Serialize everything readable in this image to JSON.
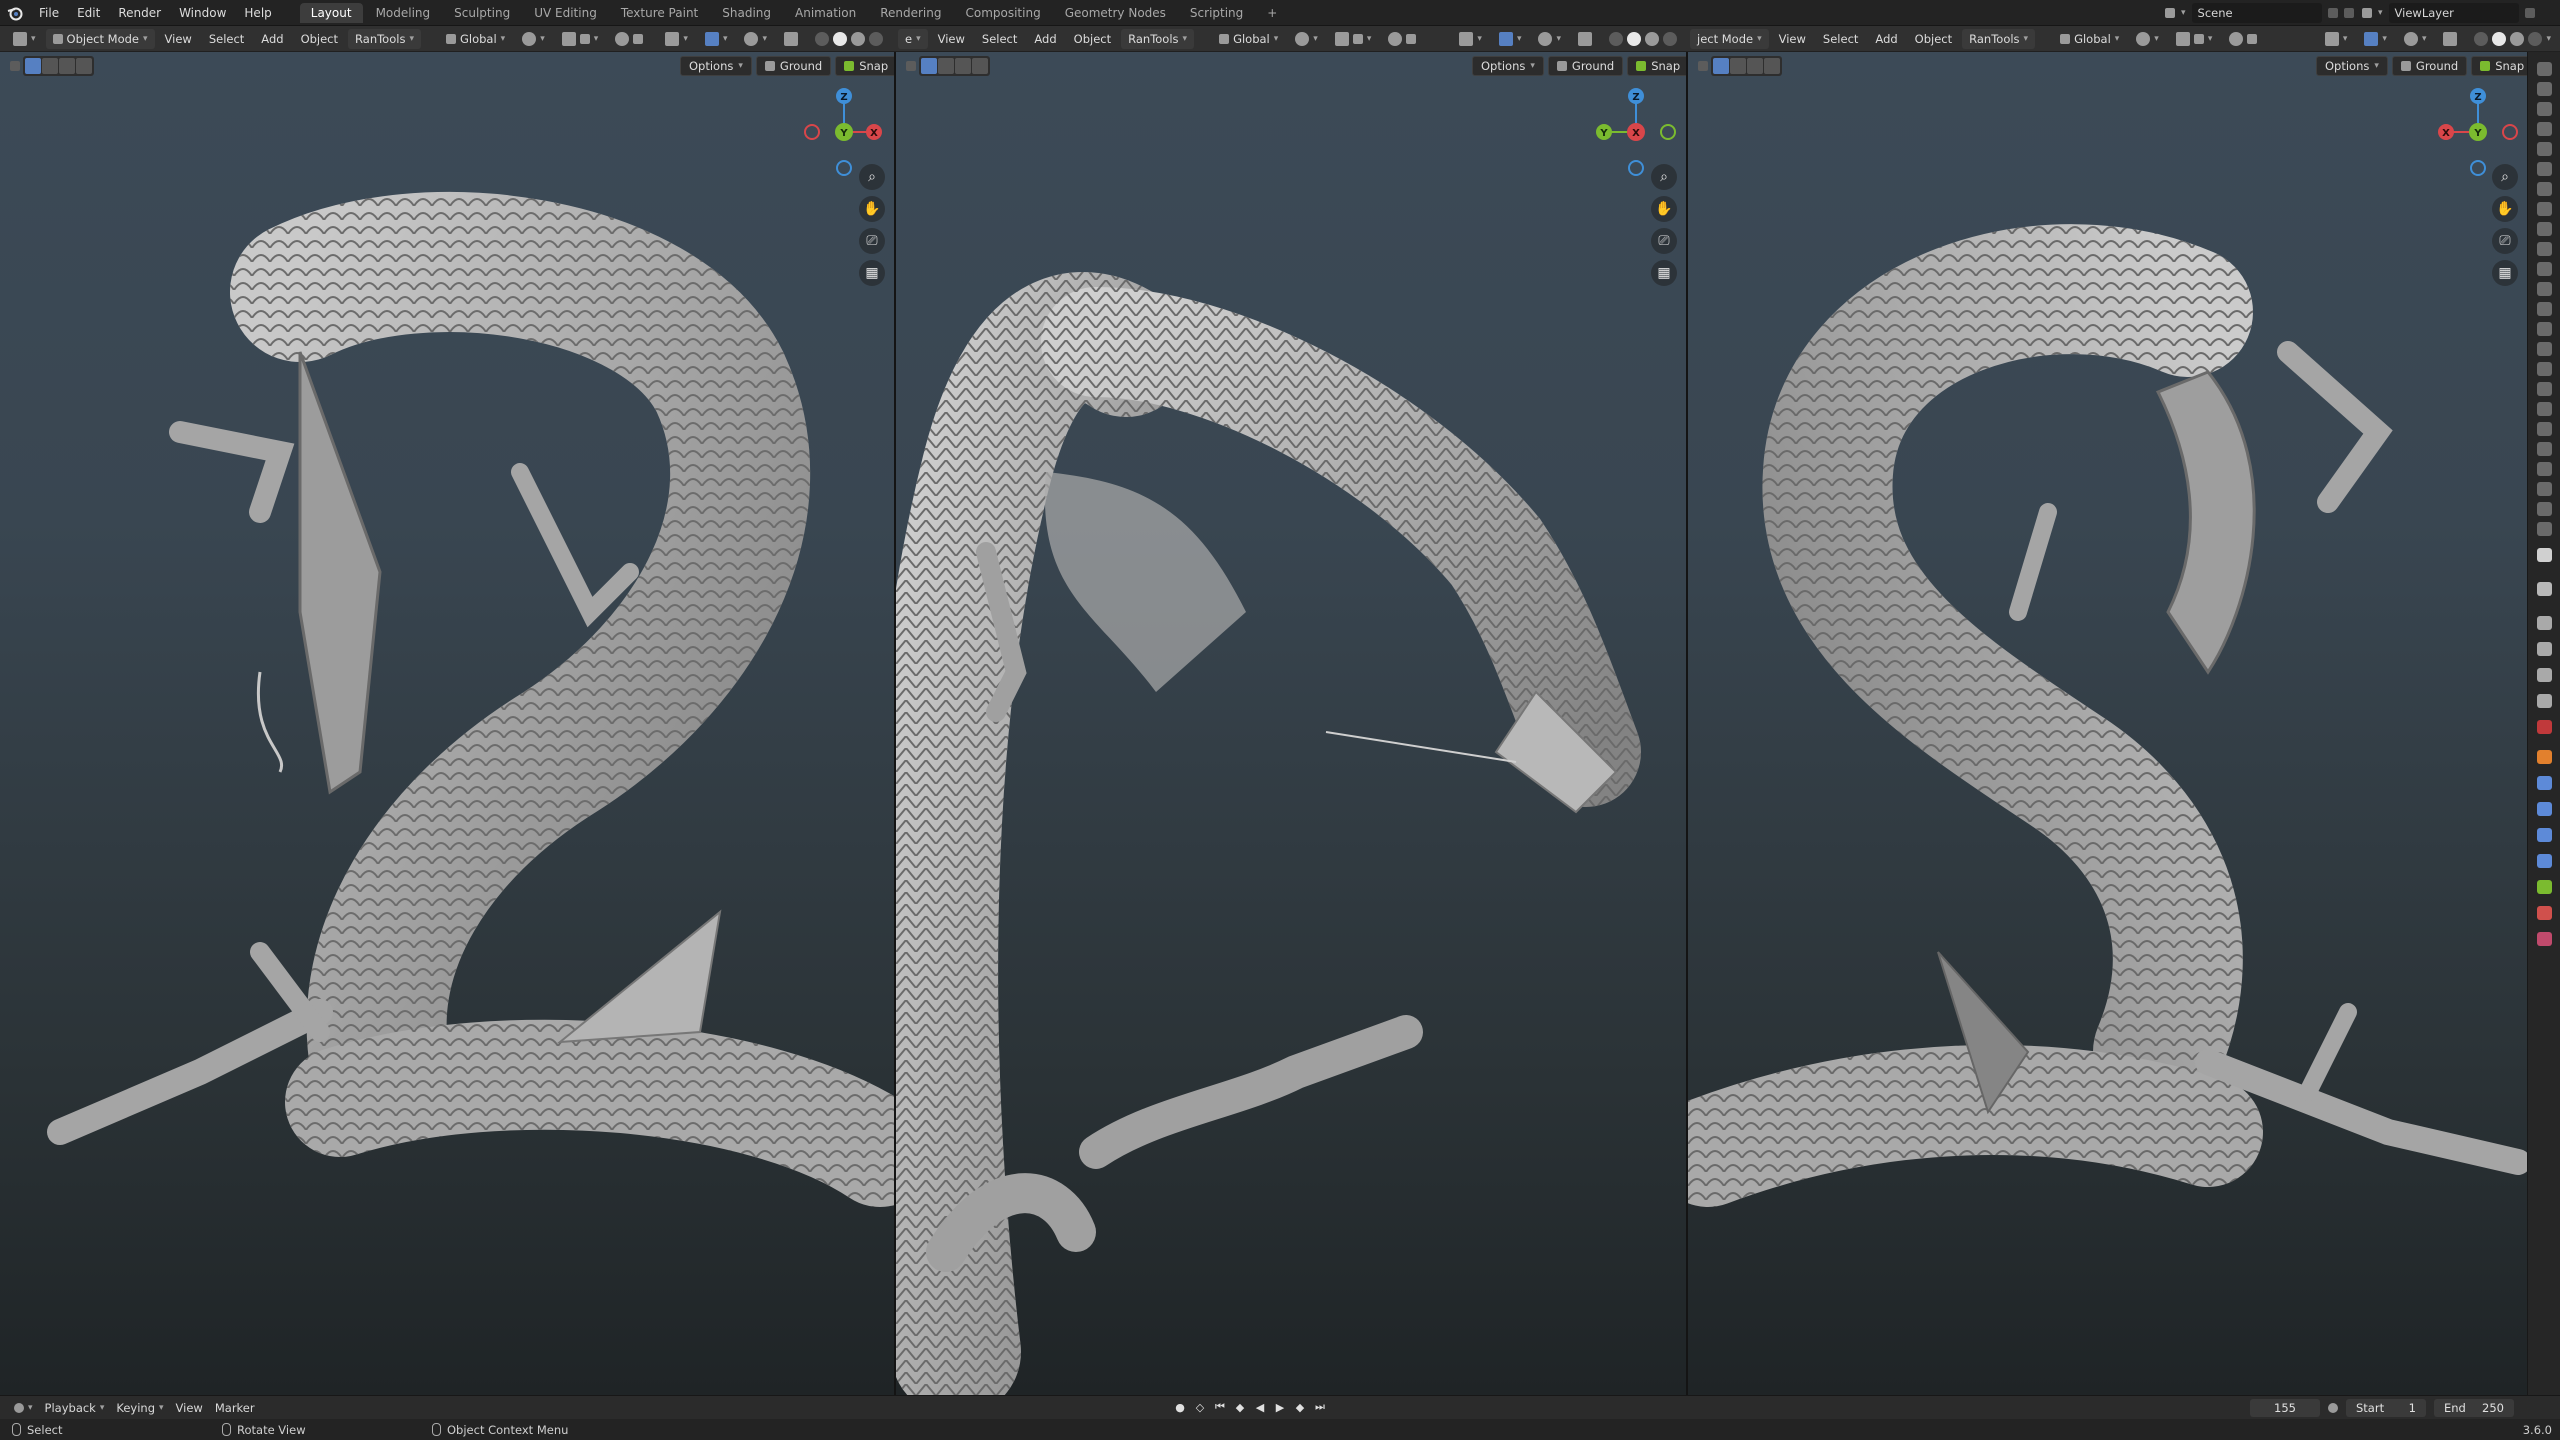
{
  "topbar": {
    "menus": [
      "File",
      "Edit",
      "Render",
      "Window",
      "Help"
    ],
    "workspaces": [
      "Layout",
      "Modeling",
      "Sculpting",
      "UV Editing",
      "Texture Paint",
      "Shading",
      "Animation",
      "Rendering",
      "Compositing",
      "Geometry Nodes",
      "Scripting"
    ],
    "active_workspace": "Layout",
    "add_tab": "+",
    "scene_label": "Scene",
    "view_layer_label": "ViewLayer"
  },
  "header": {
    "mode_full": "Object Mode",
    "mode_cut": "ject Mode",
    "mode_frag": "e",
    "view": "View",
    "select": "Select",
    "add": "Add",
    "object": "Object",
    "rantools": "RanTools",
    "orientation": "Global"
  },
  "viewport": {
    "options": "Options",
    "ground": "Ground",
    "snap": "Snap",
    "axis_x": "X",
    "axis_y": "Y",
    "axis_z": "Z"
  },
  "timeline": {
    "playback": "Playback",
    "keying": "Keying",
    "view": "View",
    "marker": "Marker",
    "current_frame": "155",
    "start_label": "Start",
    "start_value": "1",
    "end_label": "End",
    "end_value": "250"
  },
  "statusbar": {
    "select": "Select",
    "rotate_view": "Rotate View",
    "context_menu": "Object Context Menu",
    "version": "3.6.0"
  },
  "colors": {
    "accent": "#5680c2",
    "axis_x": "#d9464a",
    "axis_y": "#7bbb2f",
    "axis_z": "#3f8fd8"
  }
}
